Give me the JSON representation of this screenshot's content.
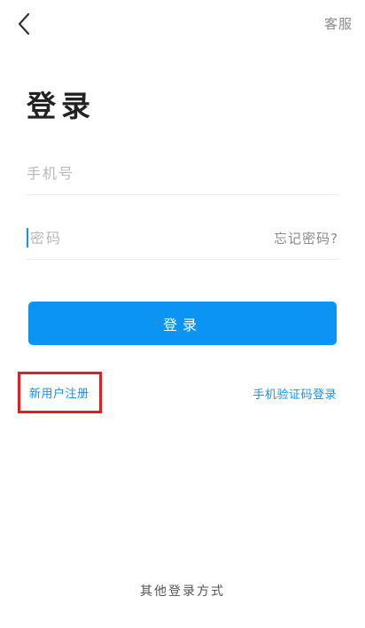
{
  "header": {
    "back_icon": "chevron-left-icon",
    "service_label": "客服"
  },
  "title": "登录",
  "phone": {
    "placeholder": "手机号",
    "value": ""
  },
  "password": {
    "placeholder": "密码",
    "value": "",
    "forgot_label": "忘记密码?"
  },
  "login_button_label": "登录",
  "register_label": "新用户注册",
  "sms_login_label": "手机验证码登录",
  "other_login_label": "其他登录方式",
  "colors": {
    "primary": "#0C94F5",
    "link": "#1591F0",
    "highlight_box": "#E02020"
  }
}
